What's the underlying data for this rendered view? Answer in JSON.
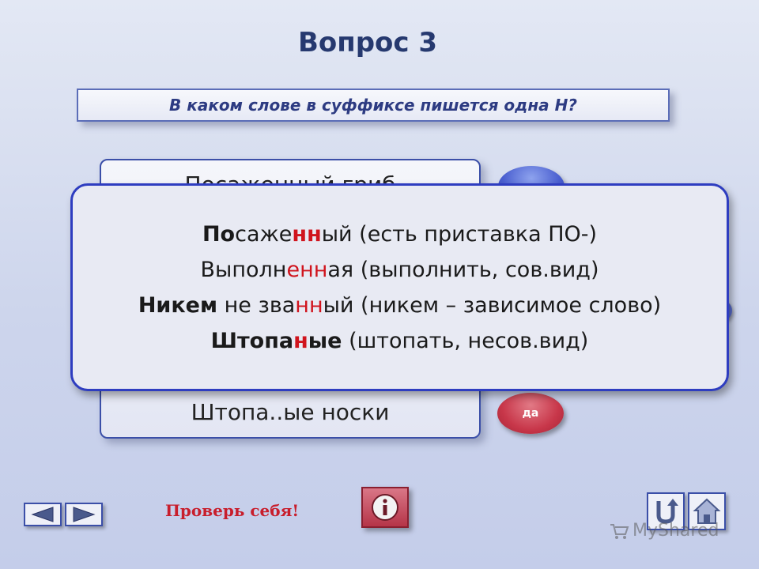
{
  "slide": {
    "title": "Вопрос 3",
    "question": "В каком слове в суффиксе пишется одна Н?"
  },
  "answers": {
    "top_partial": "Посаженный гриб",
    "bottom": "Штопа..ые носки"
  },
  "buttons": {
    "yes_label": "да",
    "check_yourself": "Проверь себя!"
  },
  "popup": {
    "line1": {
      "a": "По",
      "b": "саже",
      "c": "нн",
      "d": "ый (есть приставка ПО-)"
    },
    "line2": {
      "a": "Выполн",
      "b": "е",
      "c": "нн",
      "d": "ая (выполнить, сов.вид)"
    },
    "line3": {
      "a": "Никем",
      "b": " не зва",
      "c": "нн",
      "d": "ый (никем – зависимое слово)"
    },
    "line4": {
      "a": "Штопа",
      "b": "н",
      "c": "ые",
      "d": " (штопать, несов.вид)"
    }
  },
  "watermark": "MyShared",
  "colors": {
    "title": "#26396f",
    "accent_red": "#d0141d",
    "border_blue": "#2e3dc0"
  }
}
